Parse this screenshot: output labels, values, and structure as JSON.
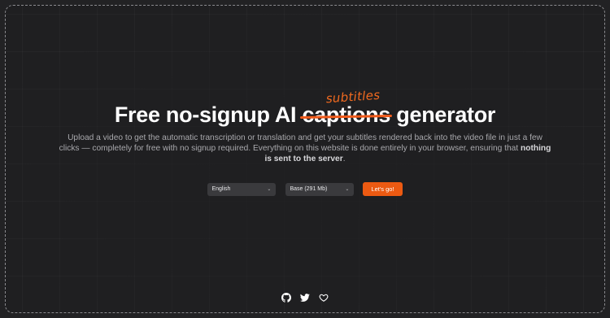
{
  "hero": {
    "title_prefix": "Free no-signup AI",
    "title_struck": "captions",
    "title_replacement": "subtitles",
    "title_suffix": "generator",
    "desc_main": "Upload a video to get the automatic transcription or translation and get your subtitles rendered back into the video file in just a few clicks — completely for free with no signup required. Everything on this website is done entirely in your browser, ensuring that",
    "desc_bold": "nothing is sent to the server",
    "desc_end": "."
  },
  "controls": {
    "language": "English",
    "model": "Base (291 Mb)",
    "submit_label": "Let's go!"
  },
  "footer": {
    "icons": [
      "github-icon",
      "twitter-icon",
      "heart-icon"
    ]
  },
  "colors": {
    "accent": "#ec5a12",
    "background": "#1f1f21",
    "text": "#ffffff"
  }
}
